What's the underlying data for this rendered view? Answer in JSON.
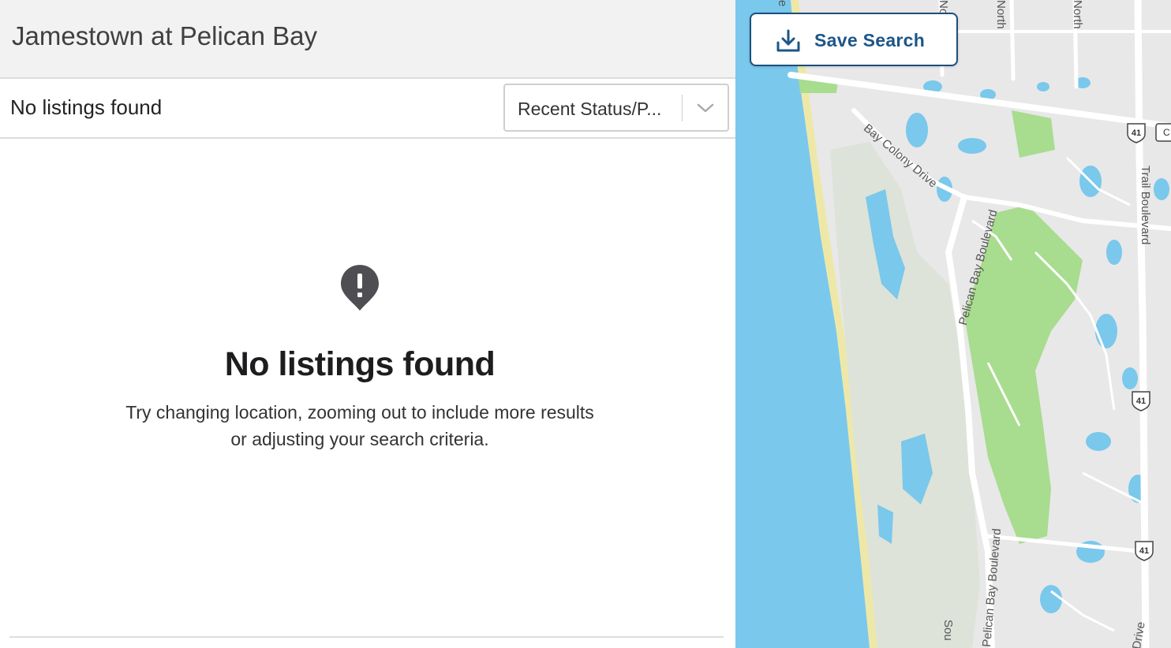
{
  "header": {
    "title": "Jamestown at Pelican Bay"
  },
  "toolbar": {
    "result_count": "No listings found",
    "sort": {
      "selected": "Recent Status/P..."
    }
  },
  "empty_state": {
    "icon": "alert-pin-icon",
    "title": "No listings found",
    "message": "Try changing location, zooming out to include more results or adjusting your search criteria."
  },
  "map": {
    "save_search_label": "Save Search",
    "labels": {
      "bay_colony": "Bay Colony Drive",
      "pelican_bay_blvd_1": "Pelican Bay Boulevard",
      "pelican_bay_blvd_2": "Pelican Bay Boulevard",
      "trail_blvd": "Trail Boulevard",
      "north_1": "North",
      "north_2": "North",
      "north_3": "No",
      "south": "Sou",
      "drive": "Drive",
      "edge": "e",
      "c_label": "C"
    },
    "route_shield": "41",
    "colors": {
      "water": "#7ac8ec",
      "park": "#a8dc8e",
      "land": "#e8e8e8",
      "road": "#ffffff",
      "brand": "#1c5687"
    }
  }
}
